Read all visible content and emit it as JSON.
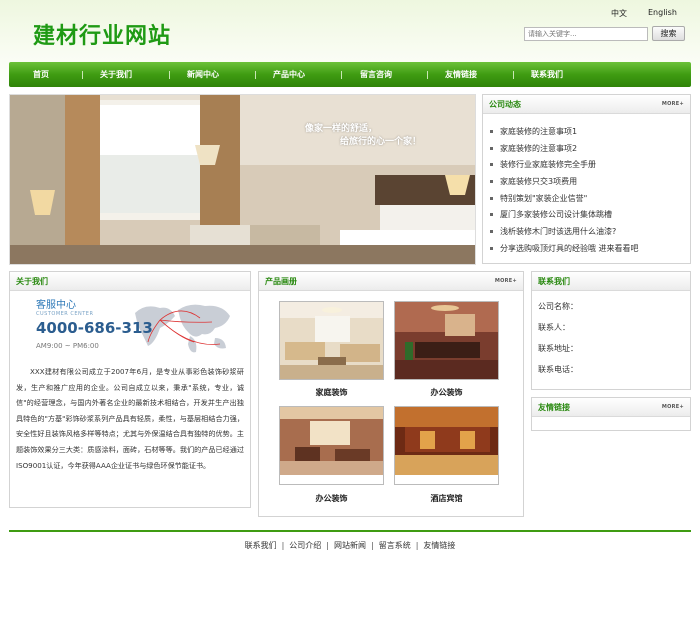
{
  "header": {
    "logo": "建材行业网站",
    "lang_zh": "中文",
    "lang_en": "English",
    "search_placeholder": "请输入关键字...",
    "search_button": "搜索"
  },
  "nav": {
    "items": [
      "首页",
      "关于我们",
      "新闻中心",
      "产品中心",
      "留言咨询",
      "友情链接",
      "联系我们"
    ]
  },
  "banner": {
    "caption_line1": "像家一样的舒适，",
    "caption_line2": "给旅行的心一个家！"
  },
  "news": {
    "title": "公司动态",
    "more": "MORE+",
    "items": [
      "家庭装修的注意事项1",
      "家庭装修的注意事项2",
      "装修行业家庭装修完全手册",
      "家庭装修只交3项费用",
      "特别策划\"家装企业信誉\"",
      "厦门多家装修公司设计集体跳槽",
      "浅析装修木门时该选用什么油漆?",
      "分享选购吸顶灯具的经验哦 进来看看吧"
    ]
  },
  "about": {
    "title": "关于我们",
    "service_title": "客服中心",
    "service_sub": "CUSTOMER CENTER",
    "phone": "4000-686-313",
    "hours": "AM9:00 ~ PM6:00",
    "text": "XXX建材有限公司成立于2007年6月，是专业从事彩色装饰砂浆研发，生产和推广应用的企业。公司自成立以来，秉承\"系统，专业，诚信\"的经营理念，与国内外著名企业的最新技术相结合，开发并生产出独具特色的\"方基\"彩饰砂浆系列产品具有轻质，柔性，与基层相结合力强，安全性好且装饰风格多样等特点；尤其与外保温结合具有独特的优势。主题装饰效果分三大类：质感涂料，面砖，石材等等。我们的产品已经通过ISO9001认证，今年获得AAA企业证书与绿色环保节能证书。"
  },
  "products": {
    "title": "产品画册",
    "more": "MORE+",
    "items": [
      "家庭装饰",
      "办公装饰",
      "办公装饰",
      "酒店宾馆"
    ]
  },
  "contact": {
    "title": "联系我们",
    "rows": [
      "公司名称：",
      "联系人：",
      "联系地址：",
      "联系电话："
    ]
  },
  "links": {
    "title": "友情链接",
    "more": "MORE+"
  },
  "footer": {
    "links": [
      "联系我们",
      "公司介绍",
      "网站新闻",
      "留言系统",
      "友情链接"
    ]
  },
  "colors": {
    "brand_green": "#1f9a14",
    "nav_green": "#3f9c12",
    "title_green": "#2b8a12"
  }
}
